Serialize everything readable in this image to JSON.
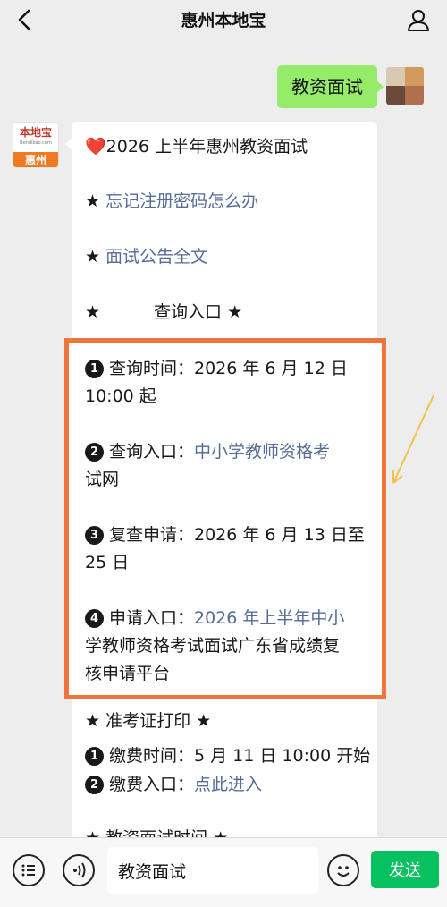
{
  "header": {
    "title": "惠州本地宝"
  },
  "outgoing": {
    "text": "教资面试"
  },
  "incoming": {
    "avatar": {
      "brand": "本地宝",
      "domain": "Bendibao.com",
      "city": "惠州"
    },
    "heart": "❤️",
    "title": "2026 上半年惠州教资面试",
    "item1_star": "★",
    "item1_link": "忘记注册密码怎么办",
    "item2_star": "★",
    "item2_link": "面试公告全文",
    "item3_star": "★",
    "item3_text": "查询入口 ★",
    "box": {
      "n1": "1",
      "l1a": "查询时间：2026 年 6 月 12 日",
      "l1b": "10:00 起",
      "n2": "2",
      "l2a_label": "查询入口：",
      "l2a_link": "中小学教师资格考",
      "l2b_link": "试网",
      "n3": "3",
      "l3a": "复查申请：2026 年 6 月 13 日至",
      "l3b": "25 日",
      "n4": "4",
      "l4a_label": "申请入口：",
      "l4a_link": "2026 年上半年中小",
      "l4b_link": "学教师资格考试面试广东省成绩复",
      "l4c_link": "核申请平台"
    },
    "admit": {
      "title": "★ 准考证打印 ★",
      "n1": "1",
      "pay_time": "缴费时间：5 月 11 日 10:00 开始",
      "n2": "2",
      "pay_label": "缴费入口：",
      "pay_link": "点此进入"
    },
    "partial_line": "★ 教资面试时间 ★"
  },
  "input_bar": {
    "input_value": "教资面试",
    "send_label": "发送"
  }
}
